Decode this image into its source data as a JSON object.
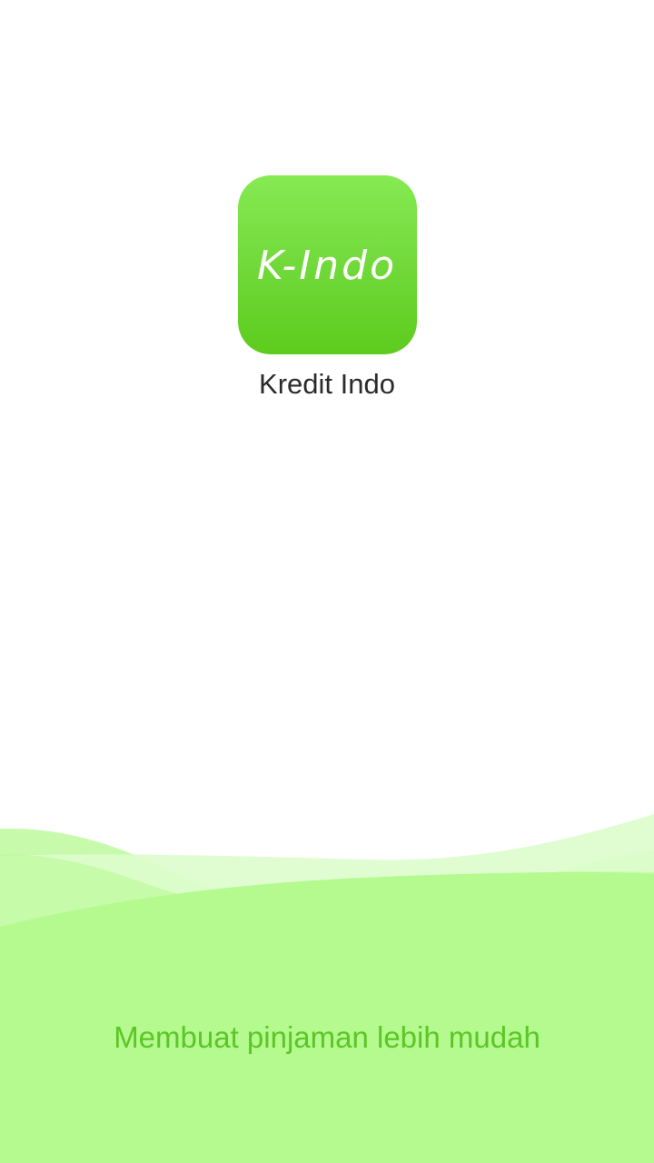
{
  "splash": {
    "icon_text": "K-Indo",
    "app_name": "Kredit Indo",
    "tagline": "Membuat pinjaman lebih mudah"
  },
  "colors": {
    "icon_top": "#86ea52",
    "icon_bottom": "#5ccc1c",
    "wave_fill": "#b4fa8f",
    "tagline": "#5cc626",
    "app_name": "#2b2b2b",
    "background": "#ffffff"
  }
}
